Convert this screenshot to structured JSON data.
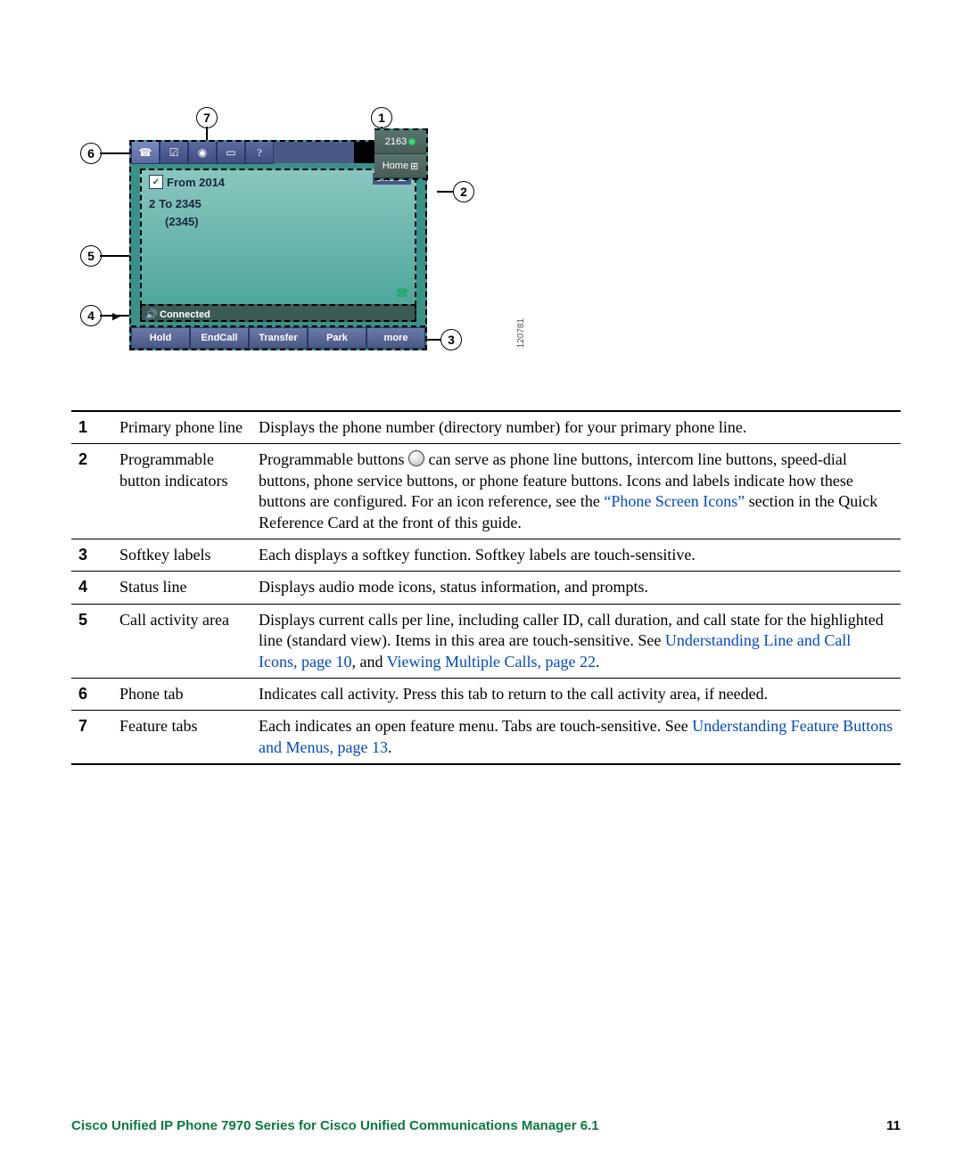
{
  "figure": {
    "primary_number": "2163",
    "side_buttons": [
      {
        "label": "2163",
        "has_led": true
      },
      {
        "label": "Home",
        "icon": "grid"
      }
    ],
    "calls": {
      "row1_text": "From 2014",
      "row1_num_prefix": "",
      "row2_num": "2",
      "row2_text": "To 2345",
      "row3_text": "(2345)",
      "timer": "1:02"
    },
    "status": "Connected",
    "softkeys": [
      "Hold",
      "EndCall",
      "Transfer",
      "Park",
      "more"
    ],
    "image_id": "120781"
  },
  "callouts": {
    "c1": "1",
    "c2": "2",
    "c3": "3",
    "c4": "4",
    "c5": "5",
    "c6": "6",
    "c7": "7"
  },
  "table": [
    {
      "num": "1",
      "name": "Primary phone line",
      "desc_plain": "Displays the phone number (directory number) for your primary phone line."
    },
    {
      "num": "2",
      "name": "Programmable button indicators",
      "desc_pre": "Programmable buttons ",
      "desc_post_icon": " can serve as phone line buttons, intercom line buttons, speed-dial buttons, phone service buttons, or phone feature buttons. Icons and labels indicate how these buttons are configured. For an icon reference, see the ",
      "link1": "“Phone Screen Icons”",
      "desc_tail": " section in the Quick Reference Card at the front of this guide."
    },
    {
      "num": "3",
      "name": "Softkey labels",
      "desc_plain": "Each displays a softkey function. Softkey labels are touch-sensitive."
    },
    {
      "num": "4",
      "name": "Status line",
      "desc_plain": "Displays audio mode icons, status information, and prompts."
    },
    {
      "num": "5",
      "name": "Call activity area",
      "desc_pre": "Displays current calls per line, including caller ID, call duration, and call state for the highlighted line (standard view). Items in this area are touch-sensitive. See ",
      "link1": "Understanding Line and Call Icons, page 10",
      "mid": ", and ",
      "link2": "Viewing Multiple Calls, page 22",
      "tail": "."
    },
    {
      "num": "6",
      "name": "Phone tab",
      "desc_plain": "Indicates call activity. Press this tab to return to the call activity area, if needed."
    },
    {
      "num": "7",
      "name": "Feature tabs",
      "desc_pre": "Each indicates an open feature menu. Tabs are touch-sensitive. See ",
      "link1": "Understanding Feature Buttons and Menus, page 13",
      "tail": "."
    }
  ],
  "footer": {
    "title": "Cisco Unified IP Phone 7970 Series for Cisco Unified Communications Manager 6.1",
    "page": "11"
  }
}
